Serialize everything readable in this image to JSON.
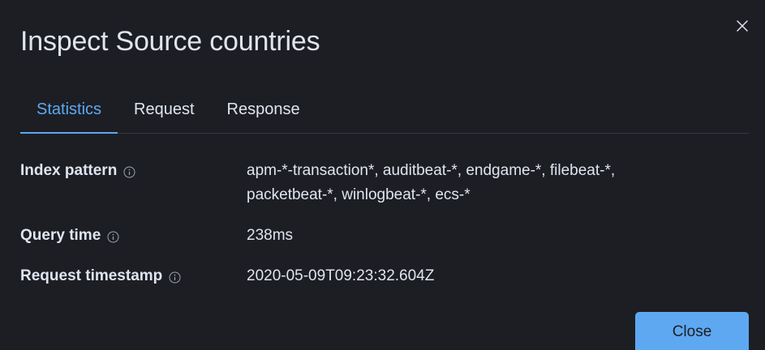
{
  "modal": {
    "title": "Inspect Source countries",
    "close_icon": "close-icon"
  },
  "tabs": [
    {
      "label": "Statistics",
      "selected": true
    },
    {
      "label": "Request",
      "selected": false
    },
    {
      "label": "Response",
      "selected": false
    }
  ],
  "stats": [
    {
      "label": "Index pattern",
      "icon": "info-icon",
      "value": "apm-*-transaction*, auditbeat-*, endgame-*, filebeat-*, packetbeat-*, winlogbeat-*, ecs-*"
    },
    {
      "label": "Query time",
      "icon": "info-icon",
      "value": "238ms"
    },
    {
      "label": "Request timestamp",
      "icon": "info-icon",
      "value": "2020-05-09T09:23:32.604Z"
    }
  ],
  "footer": {
    "close_label": "Close"
  },
  "colors": {
    "background": "#1d1e24",
    "accent": "#5ea8f2",
    "text": "#dfe5ef",
    "divider": "#343741"
  }
}
